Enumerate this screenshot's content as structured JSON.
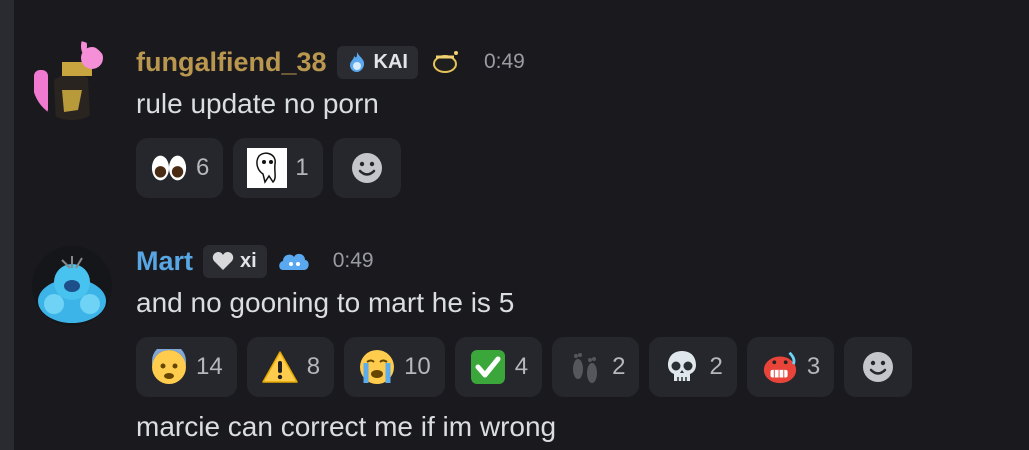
{
  "messages": [
    {
      "author": "fungalfiend_38",
      "author_color": "#b9974f",
      "role_tag": "KAI",
      "timestamp": "0:49",
      "content": "rule update no porn",
      "reactions": [
        {
          "emoji": "eyes-emoji",
          "count": "6"
        },
        {
          "emoji": "custom-ghost-emoji",
          "count": "1"
        }
      ],
      "add_reaction_icon": "smiley-add-reaction-icon"
    },
    {
      "author": "Mart",
      "author_color": "#58a7e4",
      "role_tag": "xi",
      "timestamp": "0:49",
      "content": "and no gooning to mart he is 5",
      "followup": "marcie can correct me if im wrong",
      "reactions": [
        {
          "emoji": "fearful-face-emoji",
          "count": "14"
        },
        {
          "emoji": "warning-emoji",
          "count": "8"
        },
        {
          "emoji": "loudly-crying-face-emoji",
          "count": "10"
        },
        {
          "emoji": "check-mark-button-emoji",
          "count": "4"
        },
        {
          "emoji": "footprints-emoji",
          "count": "2"
        },
        {
          "emoji": "skull-emoji",
          "count": "2"
        },
        {
          "emoji": "custom-red-grimace-emoji",
          "count": "3"
        }
      ],
      "add_reaction_icon": "smiley-add-reaction-icon"
    }
  ]
}
